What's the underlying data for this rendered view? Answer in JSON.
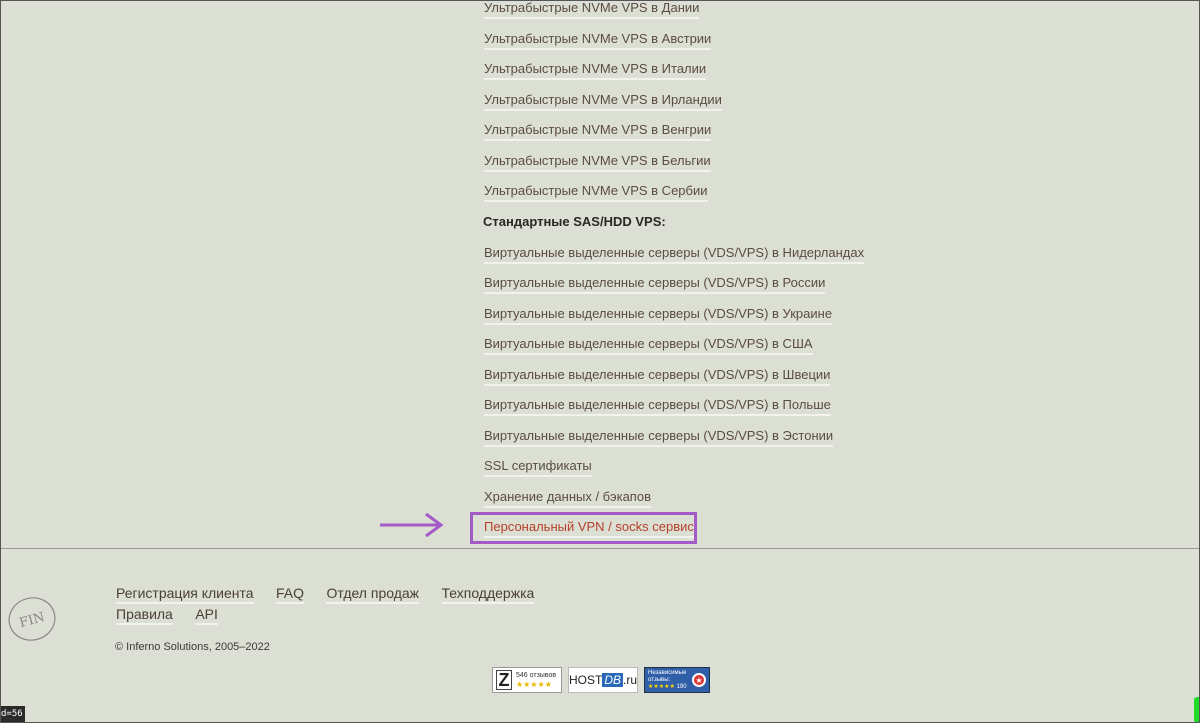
{
  "menu": {
    "nvme_items": [
      "Ультрабыстрые NVMe VPS в Дании",
      "Ультрабыстрые NVMe VPS в Австрии",
      "Ультрабыстрые NVMe VPS в Италии",
      "Ультрабыстрые NVMe VPS в Ирландии",
      "Ультрабыстрые NVMe VPS в Венгрии",
      "Ультрабыстрые NVMe VPS в Бельгии",
      "Ультрабыстрые NVMe VPS в Сербии"
    ],
    "sas_heading": "Стандартные SAS/HDD VPS:",
    "sas_items": [
      "Виртуальные выделенные серверы (VDS/VPS) в Нидерландах",
      "Виртуальные выделенные серверы (VDS/VPS) в России",
      "Виртуальные выделенные серверы (VDS/VPS) в Украине",
      "Виртуальные выделенные серверы (VDS/VPS) в США",
      "Виртуальные выделенные серверы (VDS/VPS) в Швеции",
      "Виртуальные выделенные серверы (VDS/VPS) в Польше",
      "Виртуальные выделенные серверы (VDS/VPS) в Эстонии"
    ],
    "ssl": "SSL сертификаты",
    "storage": "Хранение данных / бэкапов",
    "vpn": "Персональный VPN / socks сервис"
  },
  "footer": {
    "links": [
      "Регистрация клиента",
      "FAQ",
      "Отдел продаж",
      "Техподдержка",
      "Правила",
      "API"
    ],
    "copyright": "© Inferno Solutions, 2005–2022"
  },
  "badges": {
    "zoon_letter": "Z",
    "zoon_count": "546 отзывов",
    "zoon_stars": "★★★★★",
    "hostdb_host": "HOST",
    "hostdb_db": "DB",
    "hostdb_ru": ".ru",
    "rev_line1": "Независимые",
    "rev_line2": "отзывы:",
    "rev_stars": "★★★★★",
    "rev_count": "190"
  },
  "overlay": {
    "fin_text": "FIN",
    "id_text": "d=56"
  },
  "colors": {
    "background": "#dcdfd3",
    "highlight": "#a45bc7",
    "active_link": "#b5412a"
  }
}
